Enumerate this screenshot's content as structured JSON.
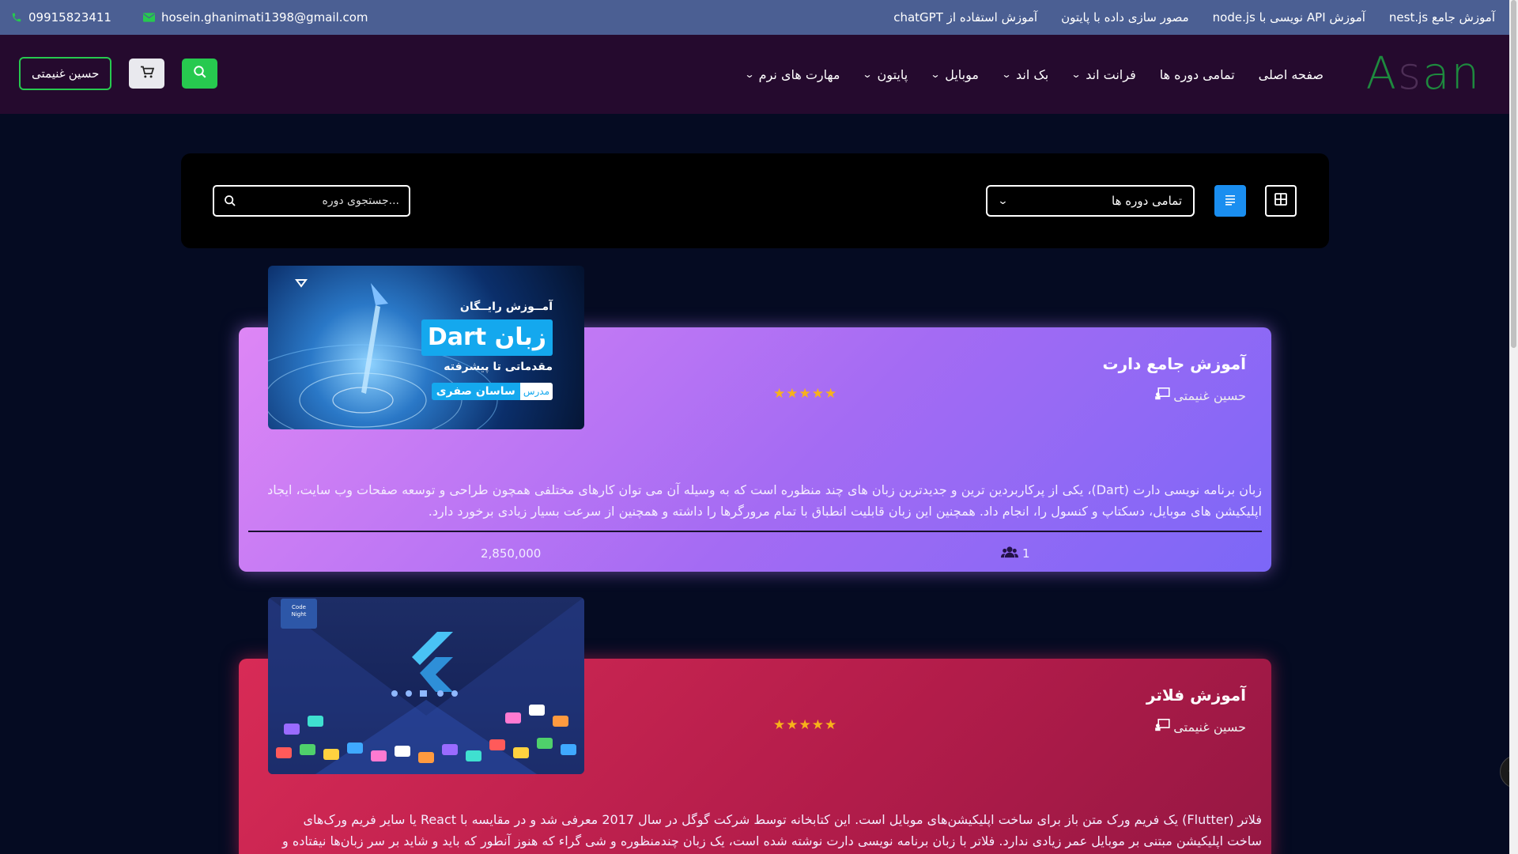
{
  "topbar": {
    "links": [
      "آموزش جامع nest.js",
      "آموزش API نویسی با node.js",
      "مصور سازی داده با پایتون",
      "آموزش استفاده از chatGPT"
    ],
    "email": "hosein.ghanimati1398@gmail.com",
    "phone": "09915823411"
  },
  "nav": {
    "logo": "Asan",
    "menu": [
      {
        "label": "صفحه اصلی",
        "dropdown": false
      },
      {
        "label": "تمامی دوره ها",
        "dropdown": false
      },
      {
        "label": "فرانت اند",
        "dropdown": true
      },
      {
        "label": "بک اند",
        "dropdown": true
      },
      {
        "label": "موبایل",
        "dropdown": true
      },
      {
        "label": "پایتون",
        "dropdown": true
      },
      {
        "label": "مهارت های نرم",
        "dropdown": true
      }
    ],
    "user_label": "حسین غنیمتی"
  },
  "filters": {
    "search_placeholder": "جستجوی دوره...",
    "category_selected": "تمامی دوره ها",
    "active_view": "list"
  },
  "courses": [
    {
      "title": "آموزش جامع دارت",
      "teacher": "حسین غنیمتی",
      "rating": 5,
      "description": "زبان برنامه نویسی دارت (Dart)، یکی از پرکاربردین ترین و جدیدترین زبان های چند منظوره است که به وسیله آن می توان کارهای مختلفی همچون طراحی و توسعه صفحات وب سایت، ایجاد اپلیکیشن های موبایل، دسکتاپ و کنسول را، انجام داد. همچنین این زبان قابلیت انطباق با تمام مرورگرها را داشته و همچنین از سرعت بسیار زیادی برخورد دارد.",
      "price": "2,850,000",
      "students": "1",
      "image": {
        "line1": "آمــوزش رایــگان",
        "line2": "زبان Dart",
        "line3": "مقدماتی تا پیشرفته",
        "tag": "مدرس",
        "name": "ساسان صفری"
      }
    },
    {
      "title": "آموزش فلاتر",
      "teacher": "حسین غنیمتی",
      "rating": 5,
      "description": "فلاتر (Flutter) یک فریم ورک متن باز برای ساخت اپلیکیشن‌های موبایل است. این کتابخانه توسط شرکت گوگل در سال 2017 معرفی شد و در مقایسه با React یا سایر فریم ورک‌های ساخت اپلیکیشن مبتنی بر موبایل عمر زیادی ندارد. فلاتر با زبان برنامه نویسی دارت نوشته شده است، یک زبان چندمنظوره و شی گراء که هنوز آنطور که باید و شاید بر سر زبان‌ها نیفتاده و محبوبیت زیادی ندارد. با یادگیری",
      "image": {
        "badge_line1": "Code",
        "badge_line2": "Night"
      }
    }
  ],
  "colors": {
    "topbar": "#4b5f93",
    "navbar": "#250a2e",
    "accent_green": "#27c94f",
    "page_bg": "#050b22",
    "star": "#f7b21a"
  }
}
